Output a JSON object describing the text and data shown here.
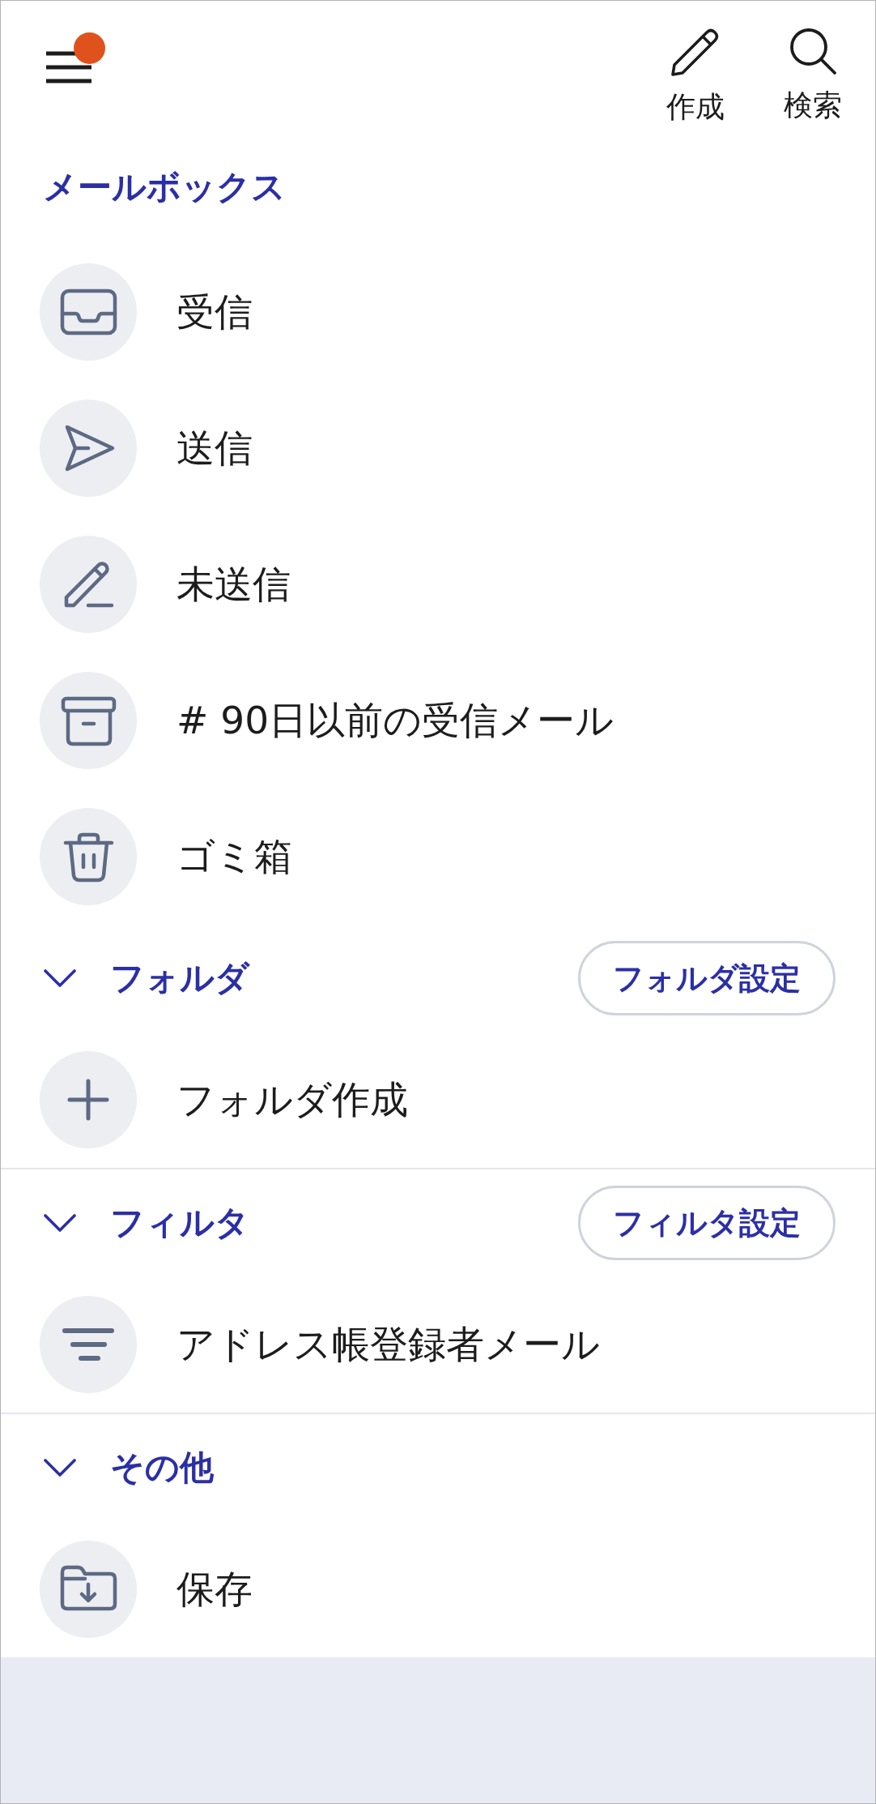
{
  "header": {
    "menu": {
      "notification": true
    },
    "actions": [
      {
        "kind": "compose",
        "label": "作成"
      },
      {
        "kind": "search",
        "label": "検索"
      }
    ]
  },
  "sections": [
    {
      "kind": "heading",
      "title": "メールボックス",
      "divider": false,
      "items": [
        {
          "kind": "inbox",
          "label": "受信"
        },
        {
          "kind": "sent",
          "label": "送信"
        },
        {
          "kind": "draft",
          "label": "未送信"
        },
        {
          "kind": "archive",
          "label": "# 90日以前の受信メール"
        },
        {
          "kind": "trash",
          "label": "ゴミ箱"
        }
      ]
    },
    {
      "kind": "group",
      "title": "フォルダ",
      "expanded": true,
      "divider": false,
      "button": "フォルダ設定",
      "items": [
        {
          "kind": "create",
          "label": "フォルダ作成"
        }
      ]
    },
    {
      "kind": "group",
      "title": "フィルタ",
      "expanded": true,
      "divider": true,
      "button": "フィルタ設定",
      "items": [
        {
          "kind": "filter",
          "label": "アドレス帳登録者メール"
        }
      ]
    },
    {
      "kind": "group",
      "title": "その他",
      "expanded": true,
      "divider": true,
      "items": [
        {
          "kind": "save",
          "label": "保存"
        }
      ]
    }
  ]
}
